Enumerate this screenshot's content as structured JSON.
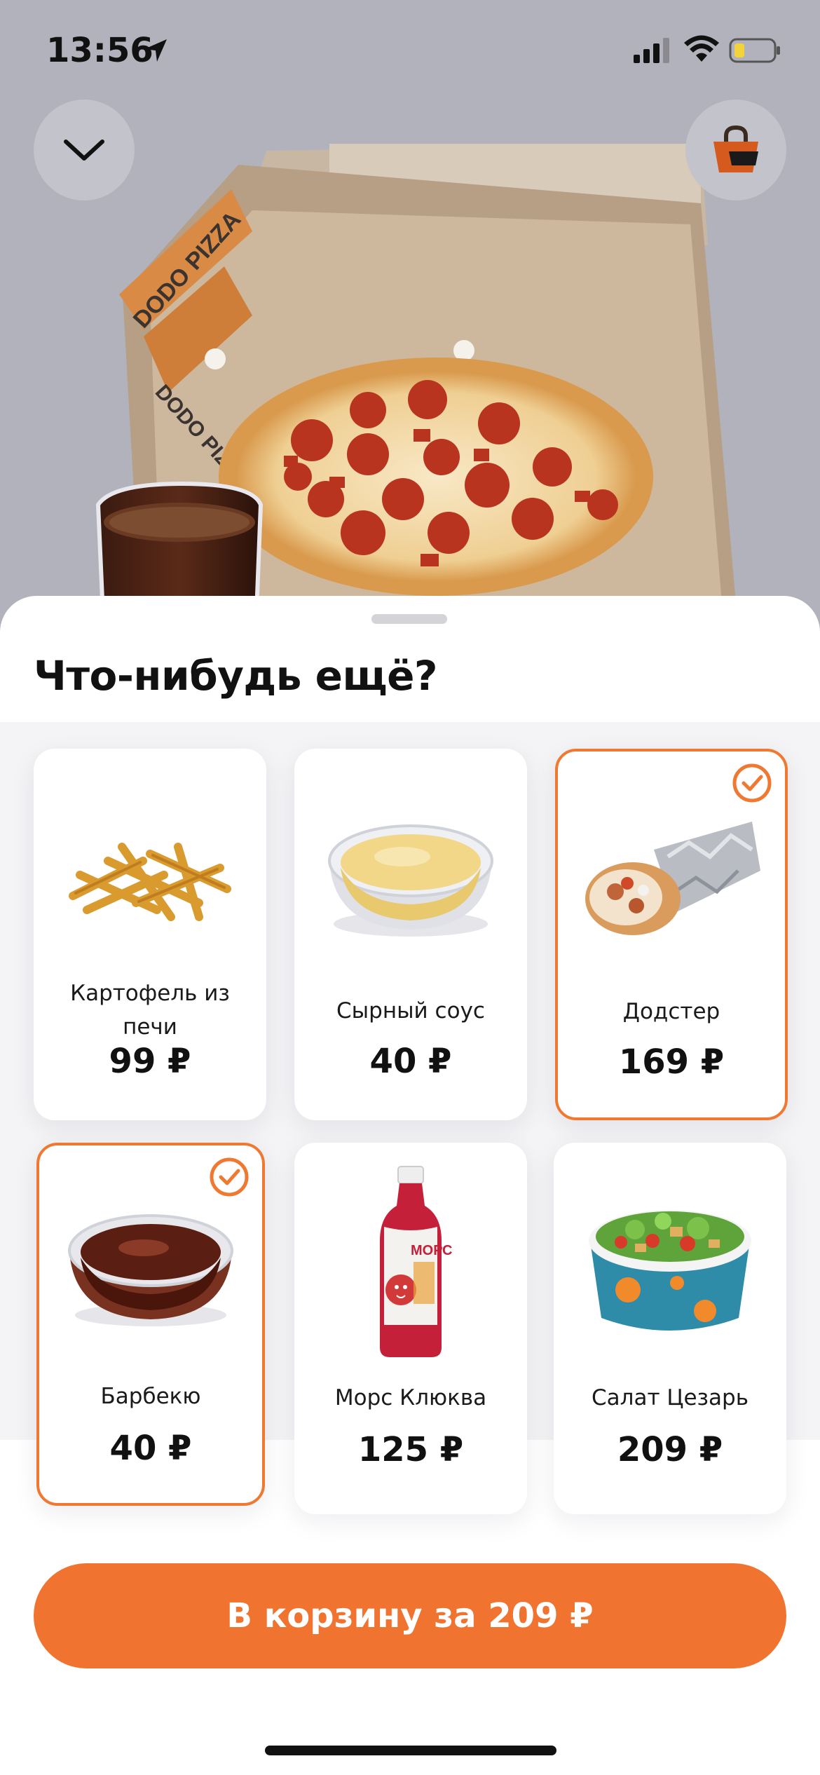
{
  "status_bar": {
    "time": "13:56",
    "icons": [
      "location-arrow-icon",
      "cellular-signal-icon",
      "wifi-icon",
      "battery-low-icon"
    ]
  },
  "header": {
    "collapse_icon": "chevron-down-icon",
    "cart_icon": "shopping-bag-icon",
    "hero_image": "pepperoni-pizza-in-box-with-cola"
  },
  "box_brand": "DODO PIZZA",
  "sheet": {
    "title": "Что-нибудь ещё?"
  },
  "products": [
    {
      "name_line1": "Картофель из",
      "name_line2": "печи",
      "price": "99 ₽",
      "selected": false,
      "image": "oven-fries-image"
    },
    {
      "name_line1": "Сырный соус",
      "name_line2": "",
      "price": "40 ₽",
      "selected": false,
      "image": "cheese-sauce-image"
    },
    {
      "name_line1": "Додстер",
      "name_line2": "",
      "price": "169 ₽",
      "selected": true,
      "image": "dodster-wrap-image"
    },
    {
      "name_line1": "Барбекю",
      "name_line2": "",
      "price": "40 ₽",
      "selected": true,
      "image": "bbq-sauce-image"
    },
    {
      "name_line1": "Морс Клюква",
      "name_line2": "",
      "price": "125 ₽",
      "selected": false,
      "image": "cranberry-mors-bottle-image"
    },
    {
      "name_line1": "Салат Цезарь",
      "name_line2": "",
      "price": "209 ₽",
      "selected": false,
      "image": "caesar-salad-bowl-image"
    }
  ],
  "bottle_label": "МОРС",
  "cta": {
    "label": "В корзину за 209 ₽"
  },
  "colors": {
    "accent": "#f07430",
    "hero_bg": "#b2b2bc",
    "grid_bg": "#f4f4f6",
    "card_bg": "#ffffff"
  }
}
